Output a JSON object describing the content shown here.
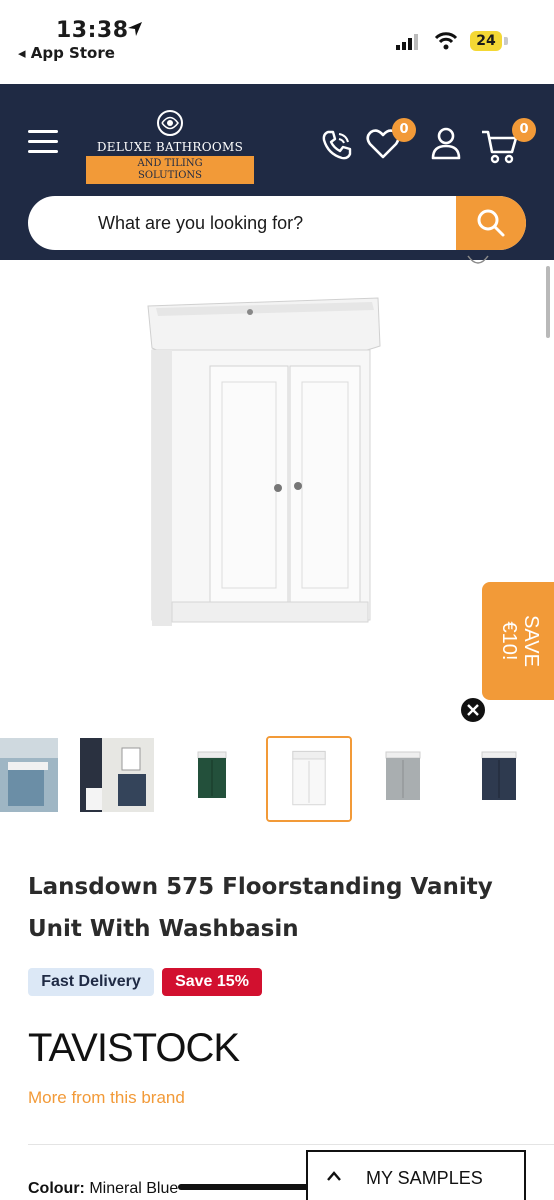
{
  "status_bar": {
    "time": "13:38",
    "back_label": "◂ App Store",
    "battery": "24"
  },
  "header": {
    "logo_line1": "DELUXE BATHROOMS",
    "logo_line2": "AND TILING",
    "logo_line3": "SOLUTIONS",
    "wishlist_count": "0",
    "cart_count": "0",
    "search_placeholder": "What are you looking for?"
  },
  "promo": {
    "save_line1": "SAVE",
    "save_line2": "€10!"
  },
  "product": {
    "title": "Lansdown 575 Floorstanding Vanity Unit With Washbasin",
    "badges": [
      "Fast Delivery",
      "Save 15%"
    ],
    "brand": "TAVISTOCK",
    "brand_link": "More from this brand",
    "colour_label": "Colour:",
    "colour_value": "Mineral Blue"
  },
  "samples": {
    "label": "MY SAMPLES"
  },
  "colors": {
    "header_bg": "#1f2a44",
    "accent": "#f29a38",
    "sale_red": "#d2102f",
    "delivery_blue": "#dce8f6"
  },
  "icons": [
    "menu-icon",
    "phone-icon",
    "heart-icon",
    "account-icon",
    "cart-icon",
    "search-icon",
    "close-icon",
    "chevron-up-icon"
  ]
}
